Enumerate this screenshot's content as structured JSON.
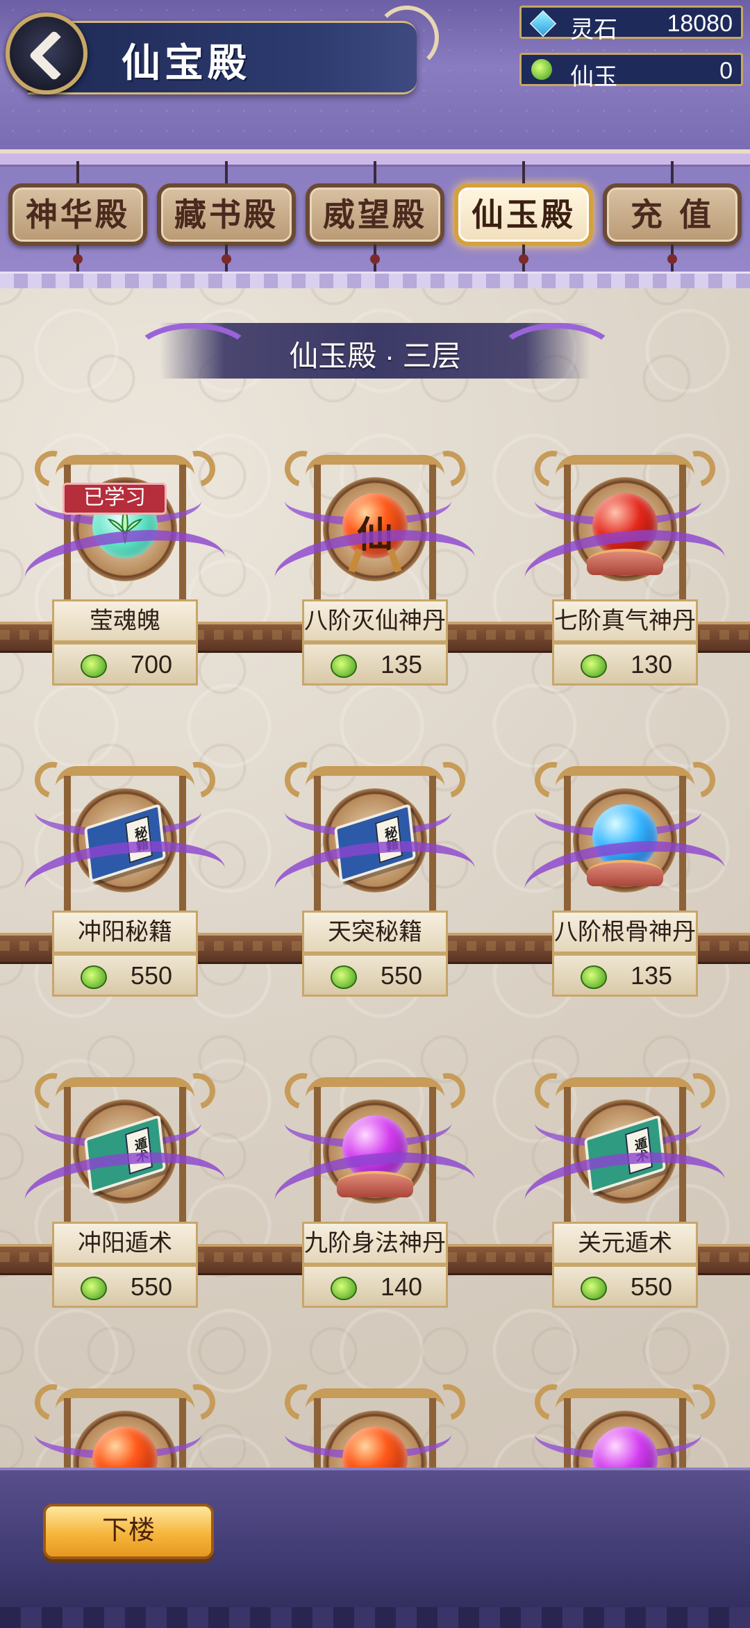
{
  "header": {
    "title": "仙宝殿",
    "currencies": [
      {
        "icon": "spirit-stone-icon",
        "label": "灵石",
        "value": "18080"
      },
      {
        "icon": "jade-icon",
        "label": "仙玉",
        "value": "0"
      }
    ]
  },
  "tabs": [
    {
      "label": "神华殿",
      "active": false
    },
    {
      "label": "藏书殿",
      "active": false
    },
    {
      "label": "威望殿",
      "active": false
    },
    {
      "label": "仙玉殿",
      "active": true
    },
    {
      "label": "充 值",
      "active": false
    }
  ],
  "floor": {
    "title": "仙玉殿 · 三层"
  },
  "items": [
    {
      "name": "莹魂魄",
      "price": "700",
      "art": "leaf-orb",
      "badge": "已学习"
    },
    {
      "name": "八阶灭仙神丹",
      "price": "135",
      "art": "red-orb-glyph",
      "glyph": "仙"
    },
    {
      "name": "七阶真气神丹",
      "price": "130",
      "art": "scarlet-orb"
    },
    {
      "name": "冲阳秘籍",
      "price": "550",
      "art": "blue-book",
      "book_label": "秘籍"
    },
    {
      "name": "天突秘籍",
      "price": "550",
      "art": "blue-book",
      "book_label": "秘籍"
    },
    {
      "name": "八阶根骨神丹",
      "price": "135",
      "art": "blue-orb"
    },
    {
      "name": "冲阳遁术",
      "price": "550",
      "art": "teal-book",
      "book_label": "遁术"
    },
    {
      "name": "九阶身法神丹",
      "price": "140",
      "art": "violet-orb"
    },
    {
      "name": "关元遁术",
      "price": "550",
      "art": "teal-book",
      "book_label": "遁术"
    }
  ],
  "footer": {
    "down_button": "下楼"
  },
  "colors": {
    "accent_gold": "#c8a765",
    "tab_active": "#fff6e0",
    "banner_navy": "#1e2a55",
    "mist_purple": "#8c44d0"
  }
}
